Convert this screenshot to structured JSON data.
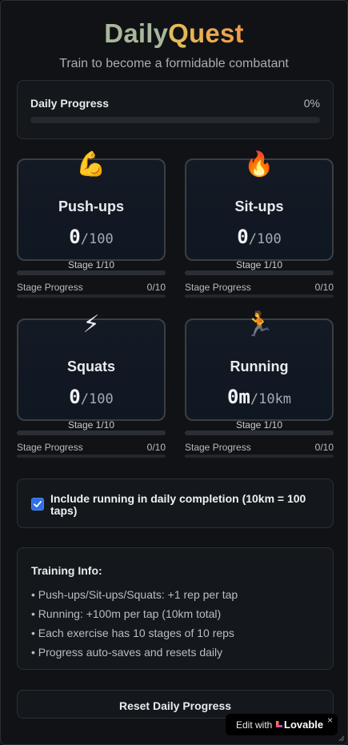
{
  "header": {
    "title_part1": "Daily",
    "title_part2": "Quest",
    "subtitle": "Train to become a formidable combatant"
  },
  "daily_progress": {
    "label": "Daily Progress",
    "percent_text": "0%",
    "percent": 0
  },
  "exercises": [
    {
      "emoji": "💪",
      "icon": "flexed-biceps-icon",
      "name": "Push-ups",
      "count": "0",
      "target": "/100",
      "stage": "Stage 1/10",
      "stage_progress_label": "Stage Progress",
      "stage_progress_value": "0/10"
    },
    {
      "emoji": "🔥",
      "icon": "fire-icon",
      "name": "Sit-ups",
      "count": "0",
      "target": "/100",
      "stage": "Stage 1/10",
      "stage_progress_label": "Stage Progress",
      "stage_progress_value": "0/10"
    },
    {
      "emoji": "⚡",
      "icon": "lightning-icon",
      "name": "Squats",
      "count": "0",
      "target": "/100",
      "stage": "Stage 1/10",
      "stage_progress_label": "Stage Progress",
      "stage_progress_value": "0/10"
    },
    {
      "emoji": "🏃",
      "icon": "runner-icon",
      "name": "Running",
      "count": "0m",
      "target": "/10km",
      "stage": "Stage 1/10",
      "stage_progress_label": "Stage Progress",
      "stage_progress_value": "0/10"
    }
  ],
  "include_running": {
    "checked": true,
    "label": "Include running in daily completion (10km = 100 taps)"
  },
  "training_info": {
    "heading": "Training Info:",
    "items": [
      "• Push-ups/Sit-ups/Squats: +1 rep per tap",
      "• Running: +100m per tap (10km total)",
      "• Each exercise has 10 stages of 10 reps",
      "• Progress auto-saves and resets daily"
    ]
  },
  "reset_button": {
    "label": "Reset Daily Progress"
  },
  "lovable_badge": {
    "edit_text": "Edit with",
    "brand": "Lovable",
    "close": "×"
  },
  "colors": {
    "accent": "#3b82f6",
    "background": "#101215",
    "card_border": "#2b2f36"
  }
}
